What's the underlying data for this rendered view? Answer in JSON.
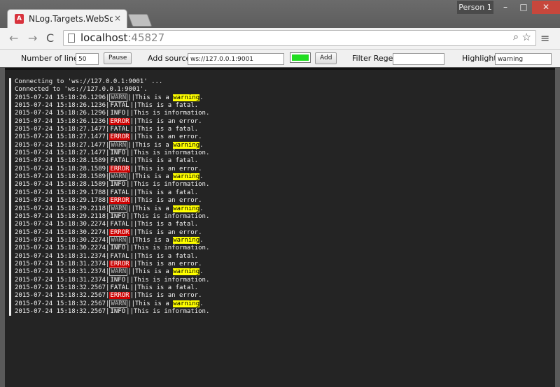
{
  "browser": {
    "tab_title": "NLog.Targets.WebSocket:",
    "tab_close": "×",
    "ng_badge": "A",
    "person_label": "Person 1",
    "url_host": "localhost",
    "url_port": ":45827",
    "min_glyph": "–",
    "max_glyph": "□",
    "close_glyph": "✕",
    "back_glyph": "←",
    "forward_glyph": "→",
    "reload_glyph": "C",
    "zoom_glyph": "⌕",
    "star_glyph": "☆",
    "menu_glyph": "≡"
  },
  "controls": {
    "lines_label": "Number of lines",
    "lines_value": "50",
    "pause_label": "Pause",
    "source_label": "Add source",
    "source_value": "ws://127.0.0.1:9001",
    "color_swatch": "#22dd22",
    "add_label": "Add",
    "filter_label": "Filter Regex",
    "filter_value": "",
    "highlight_label": "Highlight",
    "highlight_value": "warning"
  },
  "log": {
    "lines": [
      {
        "plain": "Connecting to 'ws://127.0.0.1:9001' ..."
      },
      {
        "plain": "Connected to 'ws://127.0.0.1:9001'."
      },
      {
        "ts": "2015-07-24 15:18:26.1296",
        "level": "WARN",
        "msg": "This is a ",
        "hl": "warning",
        "tail": "."
      },
      {
        "ts": "2015-07-24 15:18:26.1236",
        "level": "FATAL",
        "msg": "This is a fatal.",
        "hl": "",
        "tail": ""
      },
      {
        "ts": "2015-07-24 15:18:26.1296",
        "level": "INFO",
        "msg": "This is information.",
        "hl": "",
        "tail": ""
      },
      {
        "ts": "2015-07-24 15:18:26.1236",
        "level": "ERROR",
        "msg": "This is an error.",
        "hl": "",
        "tail": ""
      },
      {
        "ts": "2015-07-24 15:18:27.1477",
        "level": "FATAL",
        "msg": "This is a fatal.",
        "hl": "",
        "tail": ""
      },
      {
        "ts": "2015-07-24 15:18:27.1477",
        "level": "ERROR",
        "msg": "This is an error.",
        "hl": "",
        "tail": ""
      },
      {
        "ts": "2015-07-24 15:18:27.1477",
        "level": "WARN",
        "msg": "This is a ",
        "hl": "warning",
        "tail": "."
      },
      {
        "ts": "2015-07-24 15:18:27.1477",
        "level": "INFO",
        "msg": "This is information.",
        "hl": "",
        "tail": ""
      },
      {
        "ts": "2015-07-24 15:18:28.1589",
        "level": "FATAL",
        "msg": "This is a fatal.",
        "hl": "",
        "tail": ""
      },
      {
        "ts": "2015-07-24 15:18:28.1589",
        "level": "ERROR",
        "msg": "This is an error.",
        "hl": "",
        "tail": ""
      },
      {
        "ts": "2015-07-24 15:18:28.1589",
        "level": "WARN",
        "msg": "This is a ",
        "hl": "warning",
        "tail": "."
      },
      {
        "ts": "2015-07-24 15:18:28.1589",
        "level": "INFO",
        "msg": "This is information.",
        "hl": "",
        "tail": ""
      },
      {
        "ts": "2015-07-24 15:18:29.1788",
        "level": "FATAL",
        "msg": "This is a fatal.",
        "hl": "",
        "tail": ""
      },
      {
        "ts": "2015-07-24 15:18:29.1788",
        "level": "ERROR",
        "msg": "This is an error.",
        "hl": "",
        "tail": ""
      },
      {
        "ts": "2015-07-24 15:18:29.2118",
        "level": "WARN",
        "msg": "This is a ",
        "hl": "warning",
        "tail": "."
      },
      {
        "ts": "2015-07-24 15:18:29.2118",
        "level": "INFO",
        "msg": "This is information.",
        "hl": "",
        "tail": ""
      },
      {
        "ts": "2015-07-24 15:18:30.2274",
        "level": "FATAL",
        "msg": "This is a fatal.",
        "hl": "",
        "tail": ""
      },
      {
        "ts": "2015-07-24 15:18:30.2274",
        "level": "ERROR",
        "msg": "This is an error.",
        "hl": "",
        "tail": ""
      },
      {
        "ts": "2015-07-24 15:18:30.2274",
        "level": "WARN",
        "msg": "This is a ",
        "hl": "warning",
        "tail": "."
      },
      {
        "ts": "2015-07-24 15:18:30.2274",
        "level": "INFO",
        "msg": "This is information.",
        "hl": "",
        "tail": ""
      },
      {
        "ts": "2015-07-24 15:18:31.2374",
        "level": "FATAL",
        "msg": "This is a fatal.",
        "hl": "",
        "tail": ""
      },
      {
        "ts": "2015-07-24 15:18:31.2374",
        "level": "ERROR",
        "msg": "This is an error.",
        "hl": "",
        "tail": ""
      },
      {
        "ts": "2015-07-24 15:18:31.2374",
        "level": "WARN",
        "msg": "This is a ",
        "hl": "warning",
        "tail": "."
      },
      {
        "ts": "2015-07-24 15:18:31.2374",
        "level": "INFO",
        "msg": "This is information.",
        "hl": "",
        "tail": ""
      },
      {
        "ts": "2015-07-24 15:18:32.2567",
        "level": "FATAL",
        "msg": "This is a fatal.",
        "hl": "",
        "tail": ""
      },
      {
        "ts": "2015-07-24 15:18:32.2567",
        "level": "ERROR",
        "msg": "This is an error.",
        "hl": "",
        "tail": ""
      },
      {
        "ts": "2015-07-24 15:18:32.2567",
        "level": "WARN",
        "msg": "This is a ",
        "hl": "warning",
        "tail": "."
      },
      {
        "ts": "2015-07-24 15:18:32.2567",
        "level": "INFO",
        "msg": "This is information.",
        "hl": "",
        "tail": ""
      }
    ]
  }
}
